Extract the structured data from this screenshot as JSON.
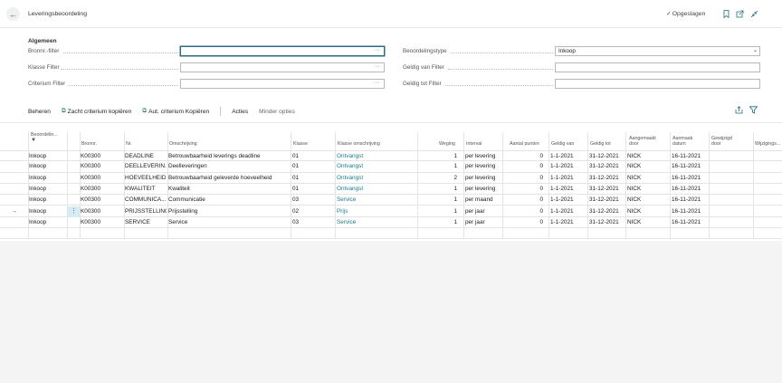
{
  "window": {
    "title": "Leveringsbeoordeling",
    "saved_label": "Opgeslagen",
    "icons": [
      "back-arrow-icon",
      "bookmark-icon",
      "open-new-window-icon",
      "collapse-icon"
    ]
  },
  "general": {
    "section_title": "Algemeen",
    "fields": {
      "bronnr_filter": {
        "label": "Bronnr.-filter",
        "value": "",
        "ellipsis": "···"
      },
      "klasse_filter": {
        "label": "Klasse Filter",
        "value": "",
        "ellipsis": "···"
      },
      "criterium_filter": {
        "label": "Criterium Filter",
        "value": "",
        "ellipsis": "···"
      },
      "beoordelingstype": {
        "label": "Beoordelingstype",
        "value": "Inkoop"
      },
      "geldig_van_filter": {
        "label": "Geldig van Filter",
        "value": ""
      },
      "geldig_tot_filter": {
        "label": "Geldig tot Filter",
        "value": ""
      }
    }
  },
  "actions": {
    "beheren": "Beheren",
    "zacht_kopieren": "Zacht criterium kopiëren",
    "aut_kopieren": "Aut. criterium Kopiëren",
    "acties": "Acties",
    "minder_opties": "Minder opties"
  },
  "table": {
    "headers": {
      "beoordeling": "Beoordelin...",
      "bronnr": "Bronnr.",
      "nr": "Nr.",
      "omschrijving": "Omschrijving",
      "klasse": "Klasse",
      "klasse_omschrijving": "Klasse omschrijving",
      "weging": "Weging",
      "interval": "Interval",
      "aantal_punten": "Aantal punten",
      "geldig_van": "Geldig van",
      "geldig_tot": "Geldig tot",
      "aangemaakt_door_1": "Aangemaakt",
      "aangemaakt_door_2": "door",
      "aanmaak_datum_1": "Aanmaak",
      "aanmaak_datum_2": "datum",
      "gewijzigd_door_1": "Gewijzigd",
      "gewijzigd_door_2": "door",
      "wijzigings": "Wijzigings..."
    },
    "rows": [
      {
        "type": "Inkoop",
        "bronnr": "K00300",
        "nr": "DEADLINE",
        "oms": "Betrouwbaarheid leverings deadline",
        "klasse": "01",
        "klasse_oms": "Ontvangst",
        "weging": "1",
        "interval": "per levering",
        "punten": "0",
        "van": "1-1-2021",
        "tot": "31-12-2021",
        "door": "NICK",
        "datum": "16-11-2021"
      },
      {
        "type": "Inkoop",
        "bronnr": "K00300",
        "nr": "DEELLEVERIN...",
        "oms": "Deelleveringen",
        "klasse": "01",
        "klasse_oms": "Ontvangst",
        "weging": "1",
        "interval": "per levering",
        "punten": "0",
        "van": "1-1-2021",
        "tot": "31-12-2021",
        "door": "NICK",
        "datum": "16-11-2021"
      },
      {
        "type": "Inkoop",
        "bronnr": "K00300",
        "nr": "HOEVEELHEID",
        "oms": "Betrouwbaarheid geleverde hoeveelheid",
        "klasse": "01",
        "klasse_oms": "Ontvangst",
        "weging": "2",
        "interval": "per levering",
        "punten": "0",
        "van": "1-1-2021",
        "tot": "31-12-2021",
        "door": "NICK",
        "datum": "16-11-2021"
      },
      {
        "type": "Inkoop",
        "bronnr": "K00300",
        "nr": "KWALITEIT",
        "oms": "Kwaliteit",
        "klasse": "01",
        "klasse_oms": "Ontvangst",
        "weging": "1",
        "interval": "per levering",
        "punten": "0",
        "van": "1-1-2021",
        "tot": "31-12-2021",
        "door": "NICK",
        "datum": "16-11-2021"
      },
      {
        "type": "Inkoop",
        "bronnr": "K00300",
        "nr": "COMMUNICA...",
        "oms": "Communicatie",
        "klasse": "03",
        "klasse_oms": "Service",
        "weging": "1",
        "interval": "per maand",
        "punten": "0",
        "van": "1-1-2021",
        "tot": "31-12-2021",
        "door": "NICK",
        "datum": "16-11-2021"
      },
      {
        "type": "Inkoop",
        "bronnr": "K00300",
        "nr": "PRIJSSTELLING",
        "oms": "Prijsstelling",
        "klasse": "02",
        "klasse_oms": "Prijs",
        "weging": "1",
        "interval": "per jaar",
        "punten": "0",
        "van": "1-1-2021",
        "tot": "31-12-2021",
        "door": "NICK",
        "datum": "16-11-2021"
      },
      {
        "type": "Inkoop",
        "bronnr": "K00300",
        "nr": "SERVICE",
        "oms": "Service",
        "klasse": "03",
        "klasse_oms": "Service",
        "weging": "1",
        "interval": "per jaar",
        "punten": "0",
        "van": "1-1-2021",
        "tot": "31-12-2021",
        "door": "NICK",
        "datum": "16-11-2021"
      }
    ],
    "selected_row": 5,
    "row_arrow": "→",
    "row_menu": "⋮"
  },
  "colors": {
    "accent": "#1a6c7a",
    "link": "#1a7d8c",
    "focus": "#2b6b85"
  }
}
